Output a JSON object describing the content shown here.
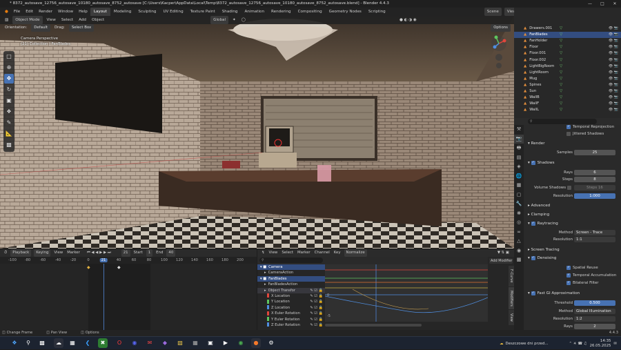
{
  "title": {
    "text": "* 8372_autosave_12756_autosave_10180_autosave_8752_autosave [C:\\Users\\Kacper\\AppData\\Local\\Temp\\8372_autosave_12756_autosave_10180_autosave_8752_autosave.blend] - Blender 4.4.3"
  },
  "menu": {
    "items": [
      "File",
      "Edit",
      "Render",
      "Window",
      "Help"
    ],
    "workspaces": [
      "Layout",
      "Modeling",
      "Sculpting",
      "UV Editing",
      "Texture Paint",
      "Shading",
      "Animation",
      "Rendering",
      "Compositing",
      "Geometry Nodes",
      "Scripting"
    ],
    "scene": "Scene",
    "view_layer": "ViewLayer"
  },
  "viewport": {
    "mode": "Object Mode",
    "menus": [
      "View",
      "Select",
      "Add",
      "Object"
    ],
    "orientation_label": "Orientation:",
    "orientation": "Default",
    "drag_label": "Drag:",
    "drag": "Select Box",
    "transform": "Global",
    "options": "Options",
    "cam_line1": "Camera Perspective",
    "cam_line2": "(21) Collection | FanBlades"
  },
  "timeline": {
    "playback": "Playback",
    "keying": "Keying",
    "view": "View",
    "marker": "Marker",
    "current": "21",
    "start_label": "Start",
    "start": "1",
    "end_label": "End",
    "end": "40",
    "ticks": [
      "-100",
      "-80",
      "-60",
      "-40",
      "-20",
      "0",
      "21",
      "40",
      "60",
      "80",
      "100",
      "120",
      "140",
      "160",
      "180",
      "200"
    ]
  },
  "graph": {
    "menus": [
      "View",
      "Select",
      "Marker",
      "Channel",
      "Key"
    ],
    "normalize": "Normalize",
    "ticks": [
      "10",
      "21",
      "30"
    ],
    "add_modifier": "Add Modifier",
    "tabs": [
      "F-Curve",
      "Modifiers",
      "View"
    ],
    "ylabels": [
      "0",
      "-5"
    ],
    "channels": [
      {
        "label": "Camera",
        "kind": "obj"
      },
      {
        "label": "CameraAction",
        "kind": "act"
      },
      {
        "label": "FanBlades",
        "kind": "obj"
      },
      {
        "label": "FanBladesAction",
        "kind": "act"
      },
      {
        "label": "Object Transfor",
        "kind": "grp"
      },
      {
        "label": "X Location",
        "color": "#e0463c"
      },
      {
        "label": "Y Location",
        "color": "#5ec65e"
      },
      {
        "label": "Z Location",
        "color": "#4f8ee0"
      },
      {
        "label": "X Euler Rotation",
        "color": "#e0463c"
      },
      {
        "label": "Y Euler Rotation",
        "color": "#5ec65e"
      },
      {
        "label": "Z Euler Rotation",
        "color": "#4f8ee0"
      }
    ]
  },
  "outliner": {
    "items": [
      {
        "name": "Drawers.001"
      },
      {
        "name": "FanBlades",
        "selected": true
      },
      {
        "name": "FanHolder"
      },
      {
        "name": "Floor"
      },
      {
        "name": "Floor.001"
      },
      {
        "name": "Floor.002"
      },
      {
        "name": "LightBigRoom"
      },
      {
        "name": "LightRoom"
      },
      {
        "name": "Mug"
      },
      {
        "name": "Spines"
      },
      {
        "name": "Sun"
      },
      {
        "name": "WallB"
      },
      {
        "name": "WallF"
      },
      {
        "name": "WallL"
      }
    ]
  },
  "props": {
    "temporal_reprojection": "Temporal Reprojection",
    "jittered_shadows": "Jittered Shadows",
    "render_section": "Render",
    "samples_label": "Samples",
    "samples": "25",
    "shadows_section": "Shadows",
    "rays_label": "Rays",
    "rays": "6",
    "steps_label": "Steps",
    "steps": "8",
    "volume_shadows_label": "Volume Shadows",
    "volume_steps_label": "Steps",
    "volume_steps": "16",
    "resolution_label": "Resolution",
    "resolution": "1:000",
    "advanced": "Advanced",
    "clamping": "Clamping",
    "raytracing": "Raytracing",
    "method_label": "Method",
    "method": "Screen - Trace",
    "rt_resolution_label": "Resolution",
    "rt_resolution": "1:1",
    "screen_tracing": "Screen Tracing",
    "denoising": "Denoising",
    "spatial_reuse": "Spatial Reuse",
    "temporal_accumulation": "Temporal Accumulation",
    "bilateral_filter": "Bilateral Filter",
    "fast_gi": "Fast GI Approximation",
    "threshold_label": "Threshold",
    "threshold": "0.500",
    "gi_method_label": "Method",
    "gi_method": "Global Illumination",
    "gi_resolution_label": "Resolution",
    "gi_resolution": "1:2",
    "gi_rays_label": "Rays",
    "gi_rays": "2"
  },
  "status": {
    "items": [
      "Change Frame",
      "Pan View",
      "Options"
    ],
    "version": "4.4.3"
  },
  "taskbar": {
    "weather": "Deszczowe dni przed...",
    "time": "14:35",
    "date": "26.05.2025"
  }
}
